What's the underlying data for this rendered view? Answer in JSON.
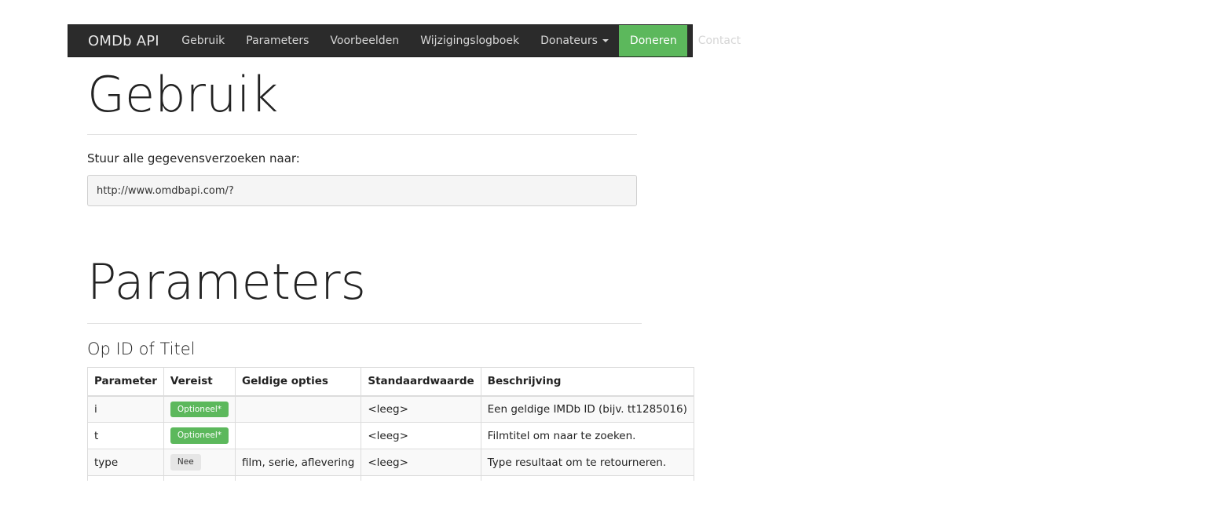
{
  "navbar": {
    "brand": "OMDb API",
    "items": [
      {
        "label": "Gebruik"
      },
      {
        "label": "Parameters"
      },
      {
        "label": "Voorbeelden"
      },
      {
        "label": "Wijzigingslogboek"
      },
      {
        "label": "Donateurs"
      },
      {
        "label": "Doneren"
      },
      {
        "label": "Contact"
      }
    ],
    "active_item": "Doneren",
    "active_color": "#5cb85c"
  },
  "usage": {
    "heading": "Gebruik",
    "intro": "Stuur alle gegevensverzoeken naar:",
    "url": "http://www.omdbapi.com/?"
  },
  "parameters": {
    "heading": "Parameters",
    "subheading": "Op ID of Titel",
    "table": {
      "headers": [
        "Parameter",
        "Vereist",
        "Geldige opties",
        "Standaardwaarde",
        "Beschrijving"
      ],
      "rows": [
        {
          "param": "i",
          "required": "Optioneel*",
          "options": "",
          "default": "<leeg>",
          "description": "Een geldige IMDb ID (bijv. tt1285016)"
        },
        {
          "param": "t",
          "required": "Optioneel*",
          "options": "",
          "default": "<leeg>",
          "description": "Filmtitel om naar te zoeken."
        },
        {
          "param": "type",
          "required": "Nee",
          "options": "film, serie, aflevering",
          "default": "<leeg>",
          "description": "Type resultaat om te retourneren."
        }
      ]
    }
  }
}
